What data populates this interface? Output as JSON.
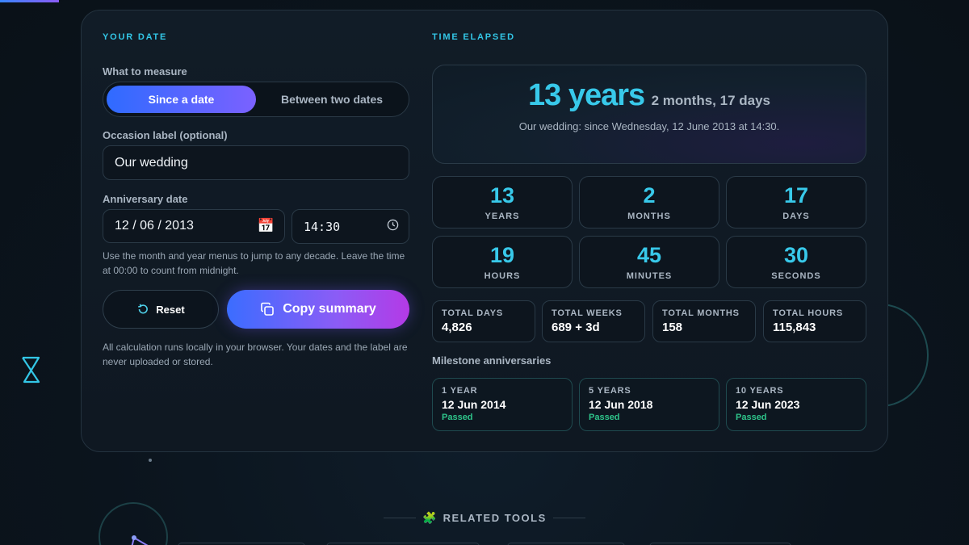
{
  "left": {
    "section_title": "YOUR DATE",
    "measure_label": "What to measure",
    "toggle_options": [
      "Since a date",
      "Between two dates"
    ],
    "occasion_label": "Occasion label (optional)",
    "occasion_value": "Our wedding",
    "date_label": "Anniversary date",
    "date_value": "12 / 06 / 2013",
    "time_value": "14:30",
    "help_text": "Use the month and year menus to jump to any decade. Leave the time at 00:00 to count from midnight.",
    "reset_label": "Reset",
    "copy_label": "Copy summary",
    "privacy_note": "All calculation runs locally in your browser. Your dates and the label are never uploaded or stored."
  },
  "right": {
    "section_title": "TIME ELAPSED",
    "hero_big": "13 years",
    "hero_small": "2 months, 17 days",
    "hero_sub": "Our wedding: since Wednesday, 12 June 2013 at 14:30.",
    "units": [
      {
        "value": "13",
        "label": "YEARS"
      },
      {
        "value": "2",
        "label": "MONTHS"
      },
      {
        "value": "17",
        "label": "DAYS"
      },
      {
        "value": "19",
        "label": "HOURS"
      },
      {
        "value": "45",
        "label": "MINUTES"
      },
      {
        "value": "30",
        "label": "SECONDS"
      }
    ],
    "totals": [
      {
        "label": "TOTAL DAYS",
        "value": "4,826"
      },
      {
        "label": "TOTAL WEEKS",
        "value": "689 + 3d"
      },
      {
        "label": "TOTAL MONTHS",
        "value": "158"
      },
      {
        "label": "TOTAL HOURS",
        "value": "115,843"
      }
    ],
    "milestones_title": "Milestone anniversaries",
    "milestones": [
      {
        "label": "1 YEAR",
        "date": "12 Jun 2014",
        "status": "Passed"
      },
      {
        "label": "5 YEARS",
        "date": "12 Jun 2018",
        "status": "Passed"
      },
      {
        "label": "10 YEARS",
        "date": "12 Jun 2023",
        "status": "Passed"
      }
    ]
  },
  "related_title": "RELATED TOOLS",
  "icons": {
    "calendar": "calendar-icon",
    "clock": "clock-icon",
    "reset": "reset-icon",
    "copy": "copy-icon",
    "puzzle": "puzzle-icon",
    "hourglass": "hourglass-icon",
    "compass": "compass-icon"
  },
  "colors": {
    "accent_cyan": "#38c9ea",
    "accent_gradient_start": "#2f6bff",
    "accent_gradient_end": "#8b5cf6",
    "passed_green": "#2ec48a"
  }
}
